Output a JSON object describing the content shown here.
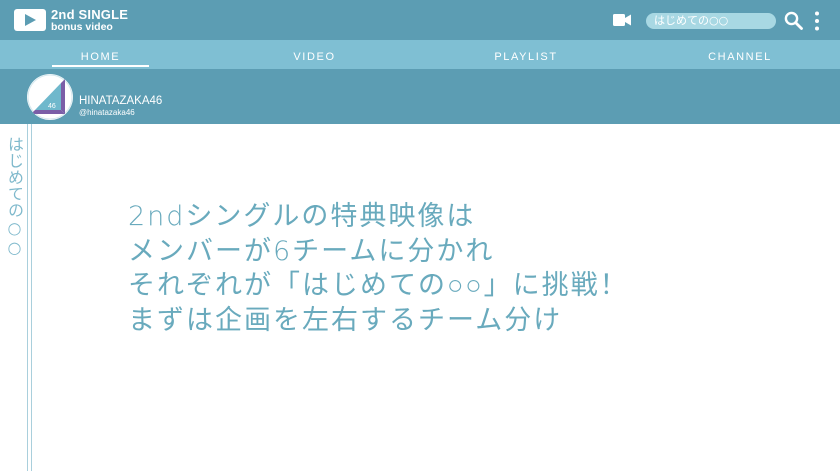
{
  "header": {
    "logo_title": "2nd SINGLE",
    "logo_subtitle": "bonus video",
    "search_value": "はじめての○○",
    "icons": {
      "logo": "play-icon",
      "camera": "video-camera-icon",
      "search": "search-icon",
      "more": "more-vertical-icon"
    }
  },
  "nav": {
    "tabs": [
      {
        "label": "HOME",
        "active": true
      },
      {
        "label": "VIDEO",
        "active": false
      },
      {
        "label": "PLAYLIST",
        "active": false
      },
      {
        "label": "CHANNEL",
        "active": false
      }
    ]
  },
  "channel": {
    "avatar_text": "46",
    "name": "HINATAZAKA46",
    "handle": "@hinatazaka46"
  },
  "sidebar": {
    "vertical_label": "はじめての○○"
  },
  "main": {
    "lines": [
      "2ndシングルの特典映像は",
      "メンバーが6チームに分かれ",
      "それぞれが「はじめての○○」に挑戦！",
      "まずは企画を左右するチーム分け"
    ]
  },
  "colors": {
    "header_bg": "#5c9db3",
    "nav_bg": "#7fbfd3",
    "search_bg": "#a8d8e3",
    "text_accent": "#69aabd",
    "avatar_purple": "#7b5ea7",
    "avatar_teal": "#6fb8cc"
  }
}
